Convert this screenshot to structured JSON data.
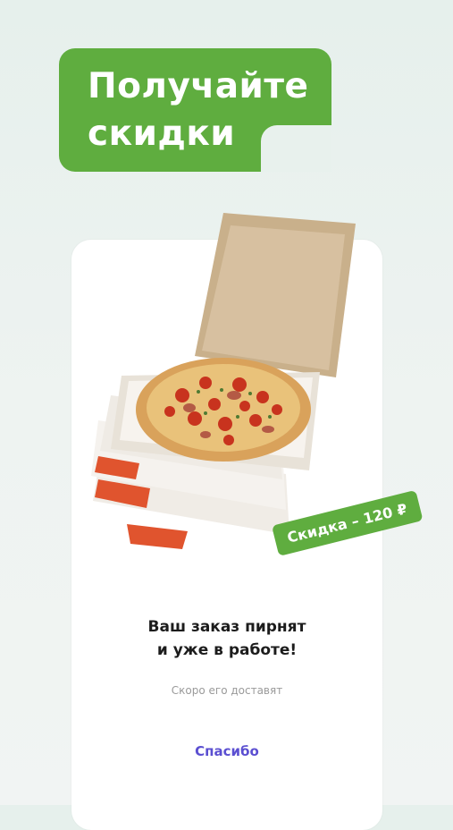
{
  "promo": {
    "title_line1": "Получайте",
    "title_line2": "скидки",
    "accent_color": "#5fad3f"
  },
  "card": {
    "image": "pizza-box-image",
    "discount_badge": "Скидка – 120 ₽",
    "order_title_line1": "Ваш заказ пирнят",
    "order_title_line2": "и уже в работе!",
    "order_subtitle": "Скоро его доставят",
    "thanks_button": "Спасибо",
    "button_color": "#5b4fd1"
  }
}
